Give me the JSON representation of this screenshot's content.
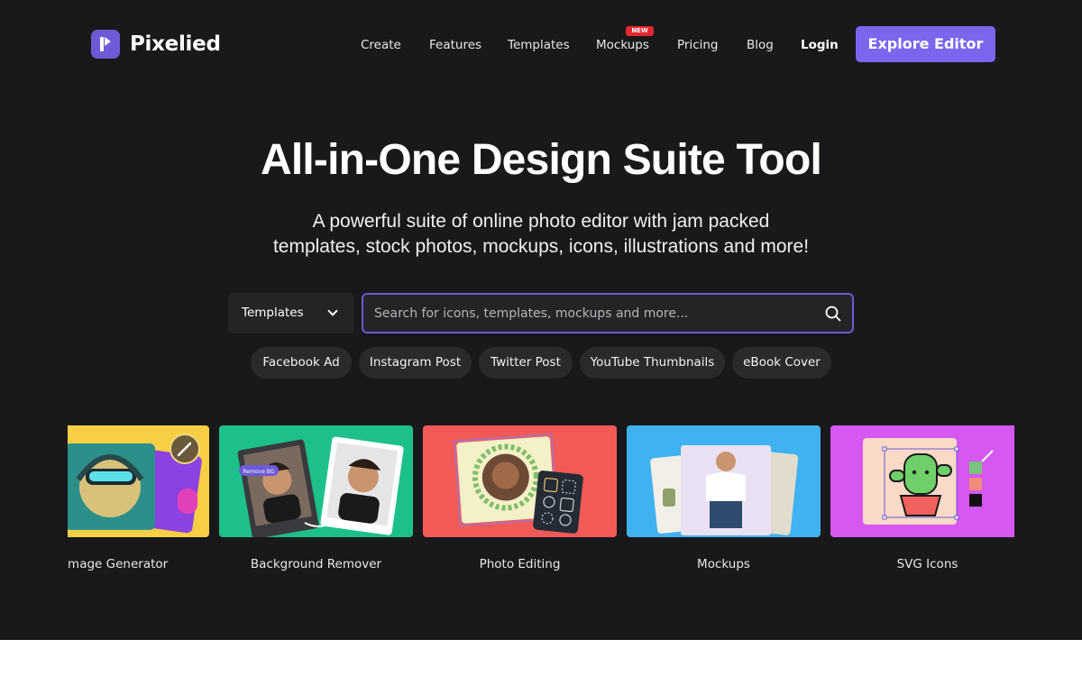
{
  "brand": {
    "name": "Pixelied",
    "accent": "#7b66ed",
    "badge_color": "#e4282f"
  },
  "nav": {
    "items": [
      {
        "label": "Create"
      },
      {
        "label": "Features"
      },
      {
        "label": "Templates"
      },
      {
        "label": "Mockups",
        "badge": "NEW"
      },
      {
        "label": "Pricing"
      },
      {
        "label": "Blog"
      }
    ],
    "login": "Login",
    "cta": "Explore Editor"
  },
  "hero": {
    "title": "All-in-One Design Suite Tool",
    "subtitle_line1": "A powerful suite of online photo editor with jam packed",
    "subtitle_line2": "templates, stock photos, mockups, icons, illustrations and more!"
  },
  "search": {
    "category": "Templates",
    "placeholder": "Search for icons, templates, mockups and more..."
  },
  "chips": [
    "Facebook Ad",
    "Instagram Post",
    "Twitter Post",
    "YouTube Thumbnails",
    "eBook Cover"
  ],
  "cards": [
    {
      "label": "I Image Generator",
      "color": "#f7cf45"
    },
    {
      "label": "Background Remover",
      "color": "#1dc08b"
    },
    {
      "label": "Photo Editing",
      "color": "#f25a58"
    },
    {
      "label": "Mockups",
      "color": "#3fb2ef"
    },
    {
      "label": "SVG Icons",
      "color": "#d558f2"
    }
  ],
  "card_tags": {
    "remove_bg": "Remove BG"
  }
}
